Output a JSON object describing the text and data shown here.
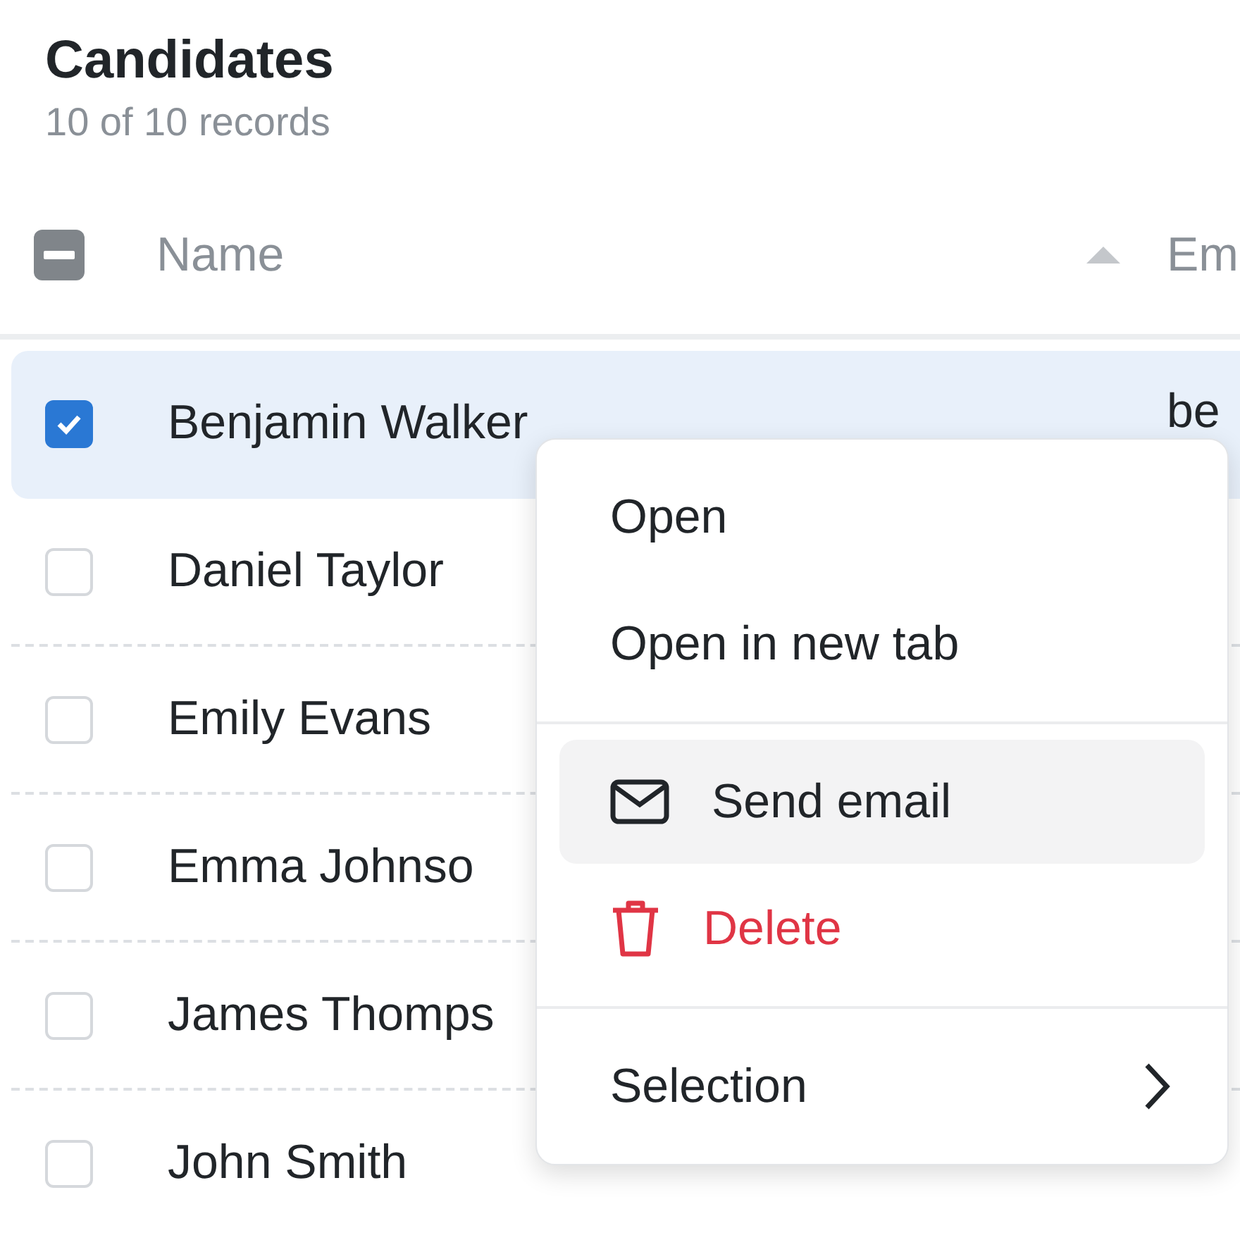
{
  "title": "Candidates",
  "subtitle": "10 of 10 records",
  "header": {
    "select_all_indeterminate": true,
    "columns": [
      {
        "label": "Name",
        "sorted_ascending": true
      },
      {
        "label": "Em"
      }
    ]
  },
  "rows": [
    {
      "name": "Benjamin Walker",
      "email": "be",
      "checked": true,
      "selected": true
    },
    {
      "name": "Daniel Taylor",
      "checked": false,
      "selected": false
    },
    {
      "name": "Emily Evans",
      "checked": false,
      "selected": false
    },
    {
      "name": "Emma Johnso",
      "checked": false,
      "selected": false
    },
    {
      "name": "James Thomps",
      "checked": false,
      "selected": false
    },
    {
      "name": "John Smith",
      "checked": false,
      "selected": false
    }
  ],
  "context_menu": {
    "items": [
      {
        "kind": "plain",
        "label": "Open",
        "highlighted": false
      },
      {
        "kind": "plain",
        "label": "Open in new tab",
        "highlighted": false
      },
      {
        "kind": "divider"
      },
      {
        "kind": "mail",
        "label": "Send email",
        "highlighted": true
      },
      {
        "kind": "delete",
        "label": "Delete",
        "highlighted": false
      },
      {
        "kind": "divider"
      },
      {
        "kind": "submenu",
        "label": "Selection",
        "highlighted": false
      }
    ]
  }
}
